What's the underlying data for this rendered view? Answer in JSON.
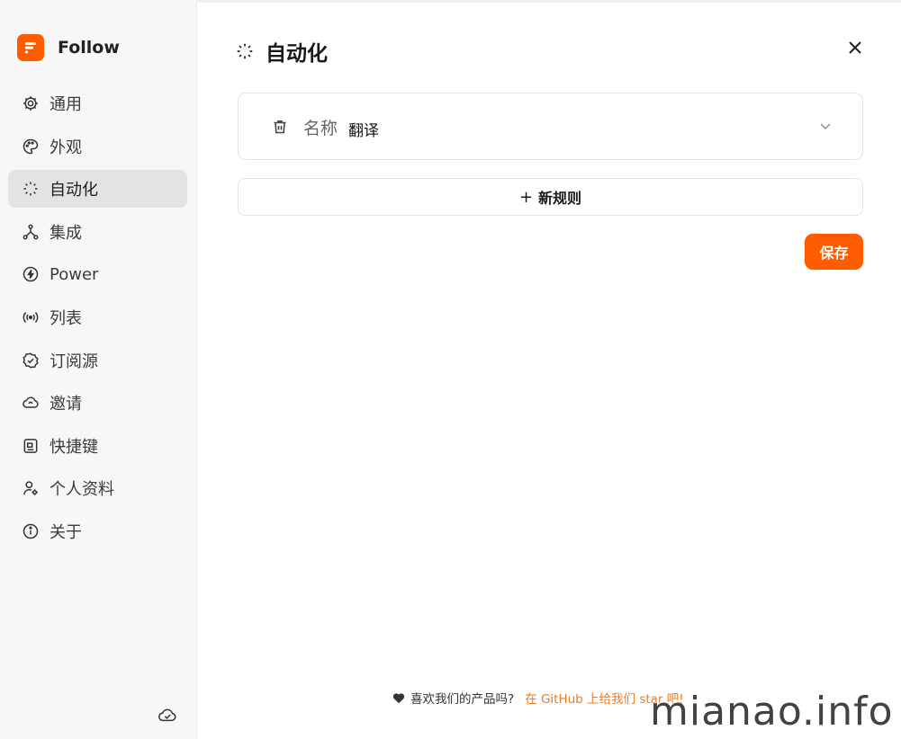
{
  "app": {
    "name": "Follow",
    "brand_color": "#ff5c00"
  },
  "sidebar": {
    "items": [
      {
        "label": "通用",
        "icon": "gear-icon",
        "active": false
      },
      {
        "label": "外观",
        "icon": "palette-icon",
        "active": false
      },
      {
        "label": "自动化",
        "icon": "magic-wand-icon",
        "active": true
      },
      {
        "label": "集成",
        "icon": "network-icon",
        "active": false
      },
      {
        "label": "Power",
        "icon": "power-bolt-icon",
        "active": false
      },
      {
        "label": "列表",
        "icon": "broadcast-icon",
        "active": false
      },
      {
        "label": "订阅源",
        "icon": "verified-badge-icon",
        "active": false
      },
      {
        "label": "邀请",
        "icon": "invite-cloud-icon",
        "active": false
      },
      {
        "label": "快捷键",
        "icon": "keyboard-icon",
        "active": false
      },
      {
        "label": "个人资料",
        "icon": "user-settings-icon",
        "active": false
      },
      {
        "label": "关于",
        "icon": "info-icon",
        "active": false
      }
    ],
    "sync_icon": "cloud-check-icon"
  },
  "main": {
    "title": "自动化",
    "rule": {
      "name_label": "名称",
      "name_value": "翻译"
    },
    "add_rule_label": "新规则",
    "save_label": "保存"
  },
  "footer": {
    "question": "喜欢我们的产品吗?",
    "link": "在 GitHub 上给我们 star 吧!"
  },
  "watermark": "mianao.info",
  "colors": {
    "accent": "#ff5c00",
    "link": "#f07b1f",
    "active_bg": "#e3e3e3"
  }
}
